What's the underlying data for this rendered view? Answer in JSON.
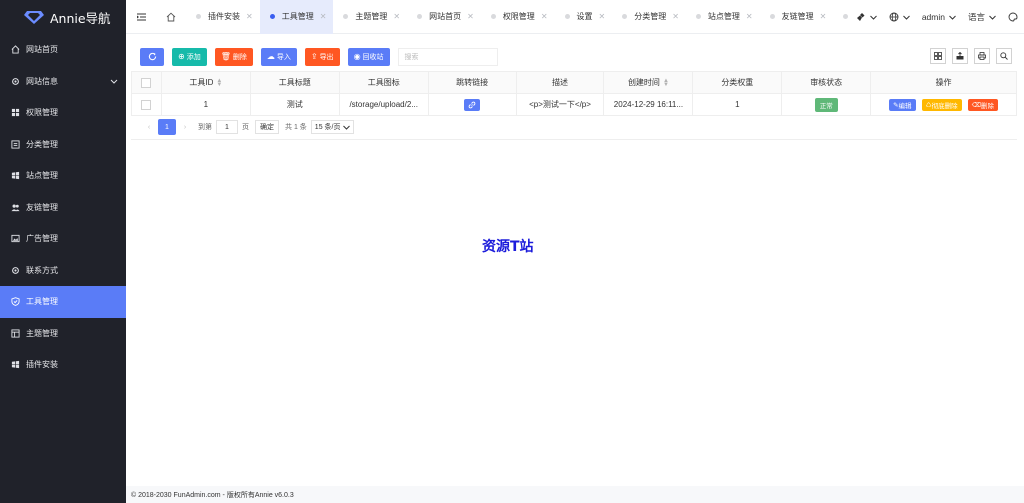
{
  "app": {
    "brand": "Annie导航"
  },
  "sidebar": {
    "items": [
      {
        "label": "网站首页",
        "icon": "home-icon"
      },
      {
        "label": "网站信息",
        "icon": "gear-icon"
      },
      {
        "label": "权限管理",
        "icon": "grid-icon"
      },
      {
        "label": "分类管理",
        "icon": "list-icon"
      },
      {
        "label": "站点管理",
        "icon": "windows-icon"
      },
      {
        "label": "友链管理",
        "icon": "users-icon"
      },
      {
        "label": "广告管理",
        "icon": "picture-icon"
      },
      {
        "label": "联系方式",
        "icon": "gear-icon"
      },
      {
        "label": "工具管理",
        "icon": "shield-icon"
      },
      {
        "label": "主题管理",
        "icon": "template-icon"
      },
      {
        "label": "插件安装",
        "icon": "windows-icon"
      }
    ]
  },
  "tabs": [
    {
      "label": "插件安装"
    },
    {
      "label": "工具管理"
    },
    {
      "label": "主题管理"
    },
    {
      "label": "网站首页"
    },
    {
      "label": "权限管理"
    },
    {
      "label": "设置"
    },
    {
      "label": "分类管理"
    },
    {
      "label": "站点管理"
    },
    {
      "label": "友链管理"
    }
  ],
  "header": {
    "user": "admin",
    "language": "语言"
  },
  "toolbar": {
    "add": "添加",
    "delete": "删除",
    "import": "导入",
    "export": "导出",
    "recycle": "回收站",
    "search_placeholder": "搜索"
  },
  "table": {
    "columns": [
      "工具ID",
      "工具标题",
      "工具图标",
      "跳转链接",
      "描述",
      "创建时间",
      "分类权重",
      "审核状态",
      "操作"
    ],
    "rows": [
      {
        "id": "1",
        "title": "测试",
        "icon": "/storage/upload/2...",
        "desc": "<p>测试一下</p>",
        "created": "2024-12-29 16:11...",
        "weight": "1",
        "status": "正常",
        "ops": {
          "edit": "编辑",
          "force_delete": "彻底删除",
          "delete": "删除"
        }
      }
    ]
  },
  "pager": {
    "current": "1",
    "goto_prefix": "到第",
    "goto_value": "1",
    "goto_suffix": "页",
    "confirm": "确定",
    "total": "共 1 条",
    "per_page": "15 条/页"
  },
  "content": {
    "center_text": "资源T站"
  },
  "footer": {
    "text": "© 2018-2030 FunAdmin.com - 版权所有Annie v6.0.3"
  },
  "colors": {
    "primary": "#5a7cf7",
    "sidebar": "#20222a",
    "teal": "#16baaa",
    "orange_red": "#ff5722",
    "yellow": "#ffb800",
    "green": "#5fb878"
  }
}
